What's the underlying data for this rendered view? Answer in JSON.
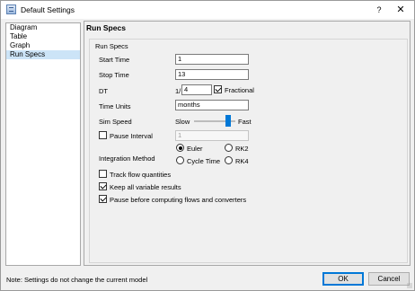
{
  "window": {
    "title": "Default Settings",
    "help_label": "?",
    "close_label": "✕"
  },
  "nav": {
    "items": [
      {
        "label": "Diagram"
      },
      {
        "label": "Table"
      },
      {
        "label": "Graph"
      },
      {
        "label": "Run Specs"
      }
    ],
    "selected": "Run Specs"
  },
  "panel": {
    "title": "Run Specs",
    "group_label": "Run Specs",
    "start_time": {
      "label": "Start Time",
      "value": "1"
    },
    "stop_time": {
      "label": "Stop Time",
      "value": "13"
    },
    "dt": {
      "label": "DT",
      "prefix": "1/",
      "value": "4",
      "fractional_label": "Fractional",
      "fractional_checked": true
    },
    "time_units": {
      "label": "Time Units",
      "value": "months"
    },
    "sim_speed": {
      "label": "Sim Speed",
      "slow_label": "Slow",
      "fast_label": "Fast",
      "level": 0.88
    },
    "pause_interval": {
      "label": "Pause Interval",
      "checked": false,
      "value": "1"
    },
    "integration": {
      "label": "Integration Method",
      "options": [
        {
          "label": "Euler",
          "checked": true
        },
        {
          "label": "RK2",
          "checked": false
        },
        {
          "label": "Cycle Time",
          "checked": false
        },
        {
          "label": "RK4",
          "checked": false
        }
      ]
    },
    "track_flow": {
      "label": "Track flow quantities",
      "checked": false
    },
    "keep_all": {
      "label": "Keep all variable results",
      "checked": true
    },
    "pause_before": {
      "label": "Pause before computing flows and converters",
      "checked": true
    }
  },
  "footer": {
    "note": "Note: Settings do not change the current model",
    "ok_label": "OK",
    "cancel_label": "Cancel"
  },
  "colors": {
    "accent": "#0078d7",
    "selection": "#cce4f7"
  }
}
